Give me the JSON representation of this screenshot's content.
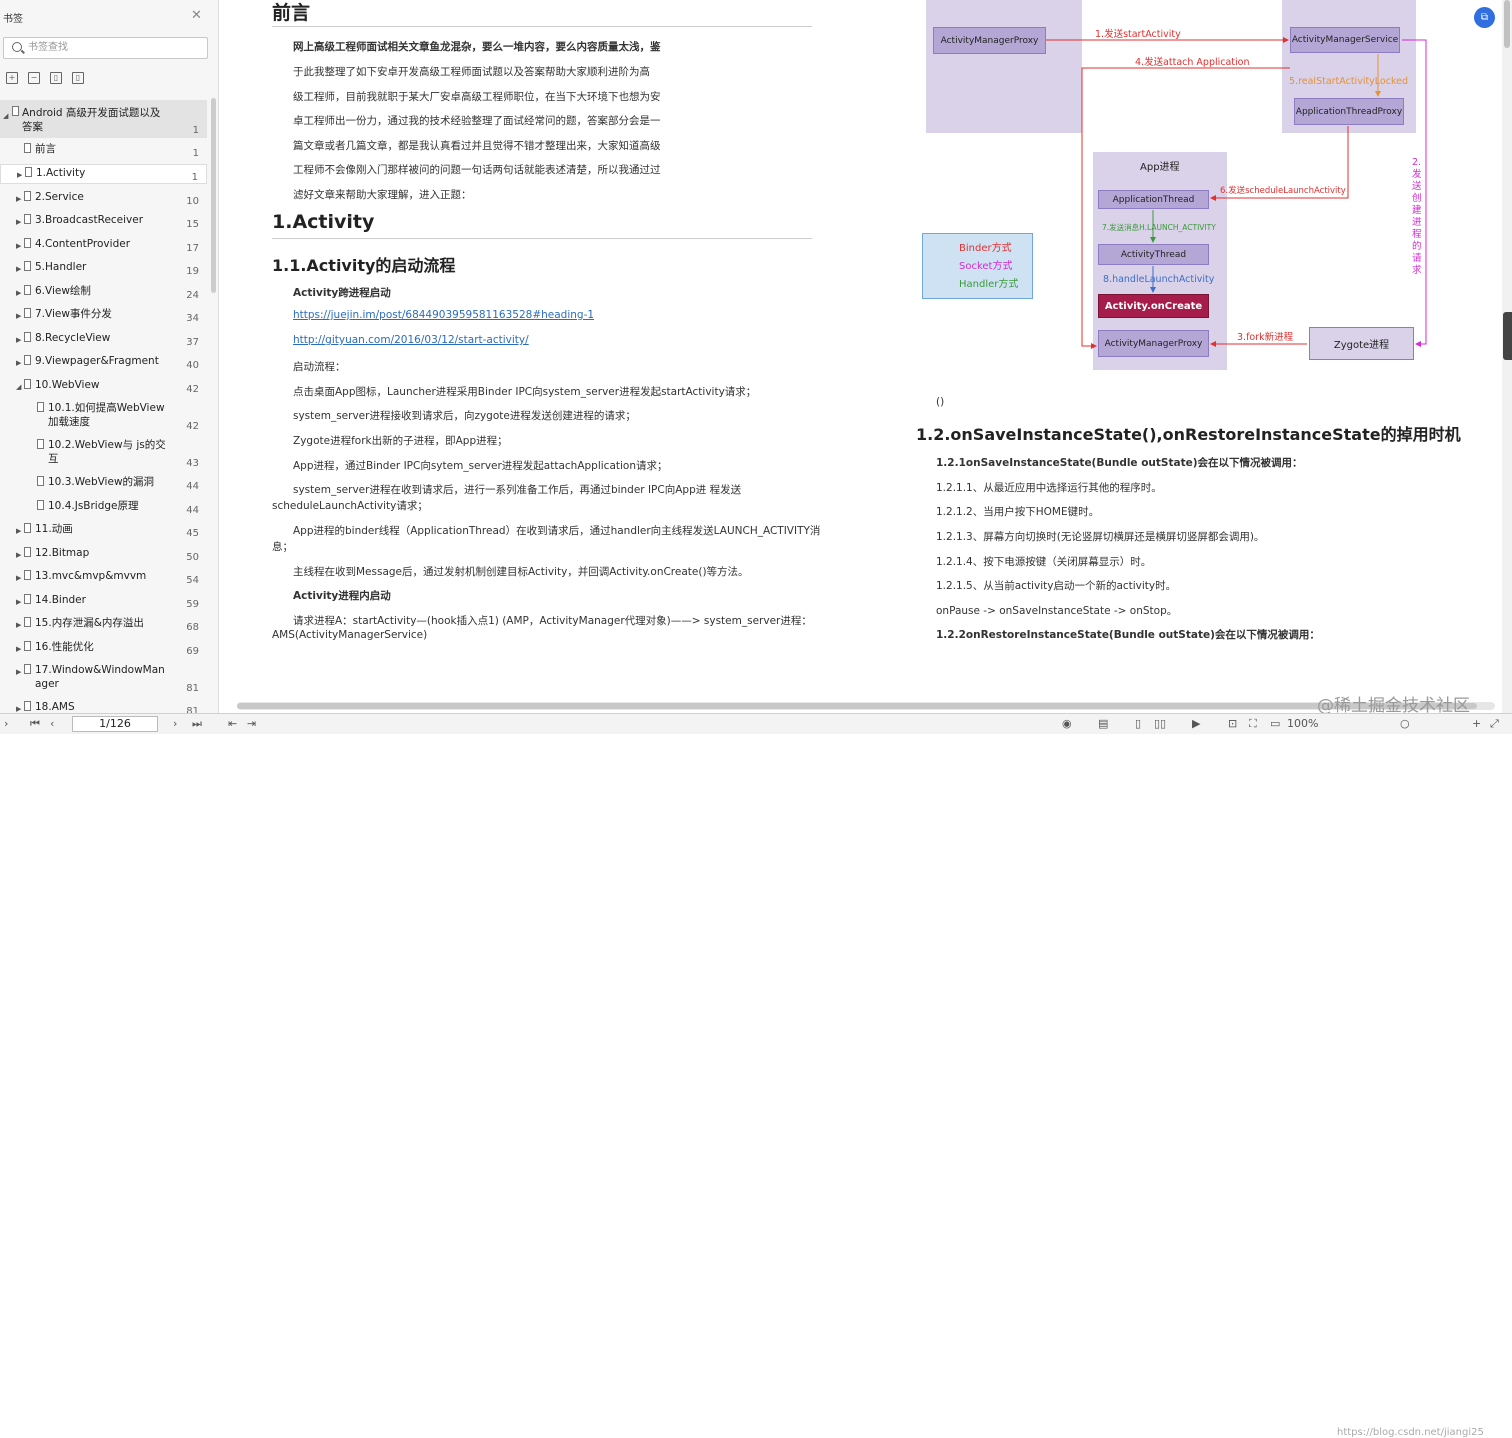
{
  "sidebar": {
    "title": "书签",
    "search_placeholder": "书签查找",
    "items": [
      {
        "label": "Android 高级开发面试题以及",
        "label2": "答案",
        "page": "1"
      },
      {
        "label": "前言",
        "page": "1"
      },
      {
        "label": "1.Activity",
        "page": "1"
      },
      {
        "label": "2.Service",
        "page": "10"
      },
      {
        "label": "3.BroadcastReceiver",
        "page": "15"
      },
      {
        "label": "4.ContentProvider",
        "page": "17"
      },
      {
        "label": "5.Handler",
        "page": "19"
      },
      {
        "label": "6.View绘制",
        "page": "24"
      },
      {
        "label": "7.View事件分发",
        "page": "34"
      },
      {
        "label": "8.RecycleView",
        "page": "37"
      },
      {
        "label": "9.Viewpager&Fragment",
        "page": "40"
      },
      {
        "label": "10.WebView",
        "page": "42"
      },
      {
        "label": "10.1.如何提高WebView",
        "label2": "加载速度",
        "page": "42"
      },
      {
        "label": "10.2.WebView与 js的交",
        "label2": "互",
        "page": "43"
      },
      {
        "label": "10.3.WebView的漏洞",
        "page": "44"
      },
      {
        "label": "10.4.JsBridge原理",
        "page": "44"
      },
      {
        "label": "11.动画",
        "page": "45"
      },
      {
        "label": "12.Bitmap",
        "page": "50"
      },
      {
        "label": "13.mvc&mvp&mvvm",
        "page": "54"
      },
      {
        "label": "14.Binder",
        "page": "59"
      },
      {
        "label": "15.内存泄漏&内存溢出",
        "page": "68"
      },
      {
        "label": "16.性能优化",
        "page": "69"
      },
      {
        "label": "17.Window&WindowMan",
        "label2": "ager",
        "page": "81"
      },
      {
        "label": "18.AMS",
        "page": "81"
      }
    ]
  },
  "left_page": {
    "title": "前言",
    "intro": [
      "网上高级工程师面试相关文章鱼龙混杂，要么一堆内容，要么内容质量太浅，鉴",
      "于此我整理了如下安卓开发高级工程师面试题以及答案帮助大家顺利进阶为高",
      "级工程师，目前我就职于某大厂安卓高级工程师职位，在当下大环境下也想为安",
      "卓工程师出一份力，通过我的技术经验整理了面试经常问的题，答案部分会是一",
      "篇文章或者几篇文章，都是我认真看过并且觉得不错才整理出来，大家知道高级",
      "工程师不会像刚入门那样被问的问题一句话两句话就能表述清楚，所以我通过过",
      "滤好文章来帮助大家理解，进入正题："
    ],
    "h_activity": "1.Activity",
    "h_launch": "1.1.Activity的启动流程",
    "cross_proc": "Activity跨进程启动",
    "link1": "https://juejin.im/post/6844903959581163528#heading-1",
    "link2": "http://gityuan.com/2016/03/12/start-activity/",
    "launch_flow": "启动流程：",
    "steps": [
      "点击桌面App图标，Launcher进程采用Binder IPC向system_server进程发起startActivity请求；",
      "system_server进程接收到请求后，向zygote进程发送创建进程的请求；",
      "Zygote进程fork出新的子进程，即App进程；",
      "App进程，通过Binder IPC向sytem_server进程发起attachApplication请求；"
    ],
    "step5a": "system_server进程在收到请求后，进行一系列准备工作后，再通过binder IPC向App进 程发送",
    "step5b": "scheduleLaunchActivity请求；",
    "step6a": "App进程的binder线程（ApplicationThread）在收到请求后，通过handler向主线程发送LAUNCH_ACTIVITY消",
    "step6b": "息；",
    "step7": "主线程在收到Message后，通过发射机制创建目标Activity，并回调Activity.onCreate()等方法。",
    "in_proc": "Activity进程内启动",
    "req_a": "请求进程A：startActivity—(hook插入点1) (AMP，ActivityManager代理对象)——> system_server进程：",
    "req_b": "AMS(ActivityManagerService)"
  },
  "diagram": {
    "amp": "ActivityManagerProxy",
    "ams": "ActivityManagerService",
    "atp": "ApplicationThreadProxy",
    "app_proc": "App进程",
    "app_thread": "ApplicationThread",
    "activity_thread": "ActivityThread",
    "on_create": "Activity.onCreate",
    "amp2": "ActivityManagerProxy",
    "zygote": "Zygote进程",
    "e1": "1.发送startActivity",
    "e4": "4.发送attach Application",
    "e5": "5.realStartActivityLocked",
    "e6": "6.发送scheduleLaunchActivity",
    "e7": "7.发送消息H.LAUNCH_ACTIVITY",
    "e8": "8.handleLaunchActivity",
    "e3": "3.fork新进程",
    "e2": "2.发送创建进程的请求",
    "legend": [
      "Binder方式",
      "Socket方式",
      "Handler方式"
    ],
    "colors": {
      "binder": "#e03030",
      "socket": "#d42ad4",
      "handler": "#3a9a3a"
    }
  },
  "right_page": {
    "paren": "()",
    "heading": "1.2.onSaveInstanceState(),onRestoreInstanceState的掉用时机",
    "sub1": "1.2.1onSaveInstanceState(Bundle outState)会在以下情况被调用：",
    "items": [
      "1.2.1.1、从最近应用中选择运行其他的程序时。",
      "1.2.1.2、当用户按下HOME键时。",
      "1.2.1.3、屏幕方向切换时(无论竖屏切横屏还是横屏切竖屏都会调用)。",
      "1.2.1.4、按下电源按键（关闭屏幕显示）时。",
      "1.2.1.5、从当前activity启动一个新的activity时。"
    ],
    "onpause": "onPause -> onSaveInstanceState -> onStop。",
    "sub2": "1.2.2onRestoreInstanceState(Bundle outState)会在以下情况被调用："
  },
  "status": {
    "page": "1/126",
    "zoom": "100%"
  },
  "watermark": "@稀土掘金技术社区",
  "watermark_url": "https://blog.csdn.net/jiangi25"
}
